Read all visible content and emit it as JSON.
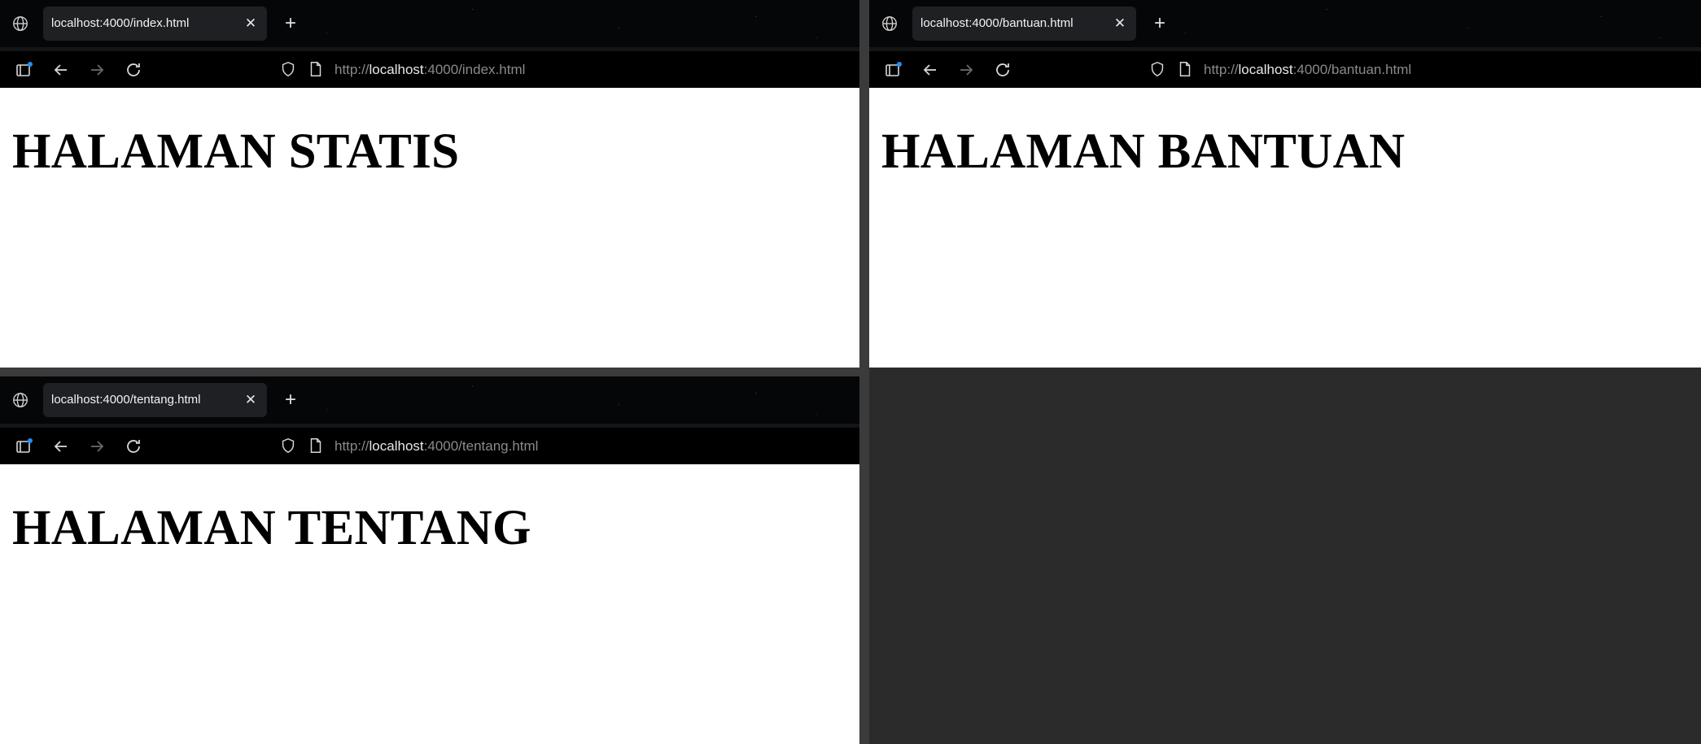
{
  "windows": [
    {
      "tab_title": "localhost:4000/index.html",
      "url_scheme": "http://",
      "url_host": "localhost",
      "url_rest": ":4000/index.html",
      "heading": "HALAMAN STATIS"
    },
    {
      "tab_title": "localhost:4000/bantuan.html",
      "url_scheme": "http://",
      "url_host": "localhost",
      "url_rest": ":4000/bantuan.html",
      "heading": "HALAMAN BANTUAN"
    },
    {
      "tab_title": "localhost:4000/tentang.html",
      "url_scheme": "http://",
      "url_host": "localhost",
      "url_rest": ":4000/tentang.html",
      "heading": "HALAMAN TENTANG"
    }
  ],
  "icons": {
    "site": "globe-icon",
    "close": "close-icon",
    "new_tab": "plus-icon",
    "sidebar": "sidebar-toggle-icon",
    "back": "back-arrow-icon",
    "forward": "forward-arrow-icon",
    "reload": "reload-icon",
    "tracking": "shield-icon",
    "page": "page-icon"
  },
  "colors": {
    "chrome": "#000000",
    "tab_active": "#1f2023",
    "desktop": "#2b2b2b",
    "badge": "#1e90ff"
  }
}
